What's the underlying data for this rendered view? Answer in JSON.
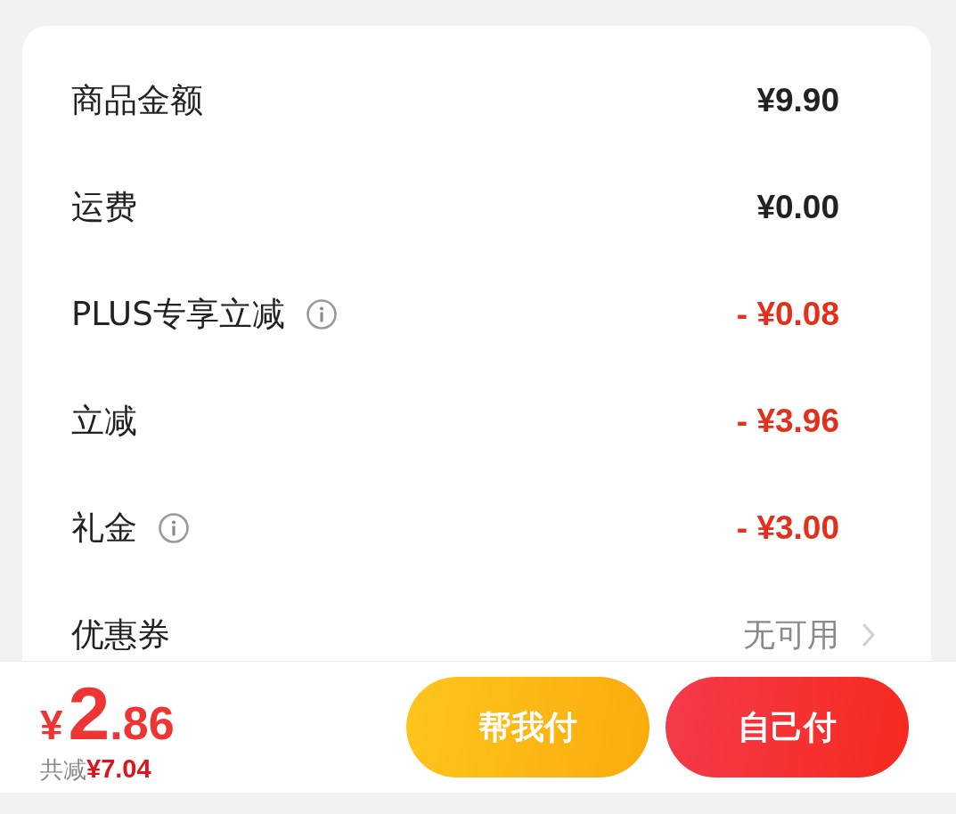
{
  "rows": [
    {
      "label": "商品金额",
      "info": false,
      "value": "¥9.90",
      "kind": "amount"
    },
    {
      "label": "运费",
      "info": false,
      "value": "¥0.00",
      "kind": "amount"
    },
    {
      "label": "PLUS专享立减",
      "info": true,
      "value": "- ¥0.08",
      "kind": "discount"
    },
    {
      "label": "立减",
      "info": false,
      "value": "- ¥3.96",
      "kind": "discount"
    },
    {
      "label": "礼金",
      "info": true,
      "value": "- ¥3.00",
      "kind": "discount"
    },
    {
      "label": "优惠券",
      "info": false,
      "value": "无可用",
      "kind": "link"
    }
  ],
  "footer": {
    "total": {
      "currency": "¥",
      "integer": "2",
      "decimal": ".86"
    },
    "savings_label": "共减",
    "savings_value": "¥7.04"
  },
  "buttons": [
    {
      "label": "帮我付",
      "kind": "secondary"
    },
    {
      "label": "自己付",
      "kind": "primary"
    }
  ]
}
